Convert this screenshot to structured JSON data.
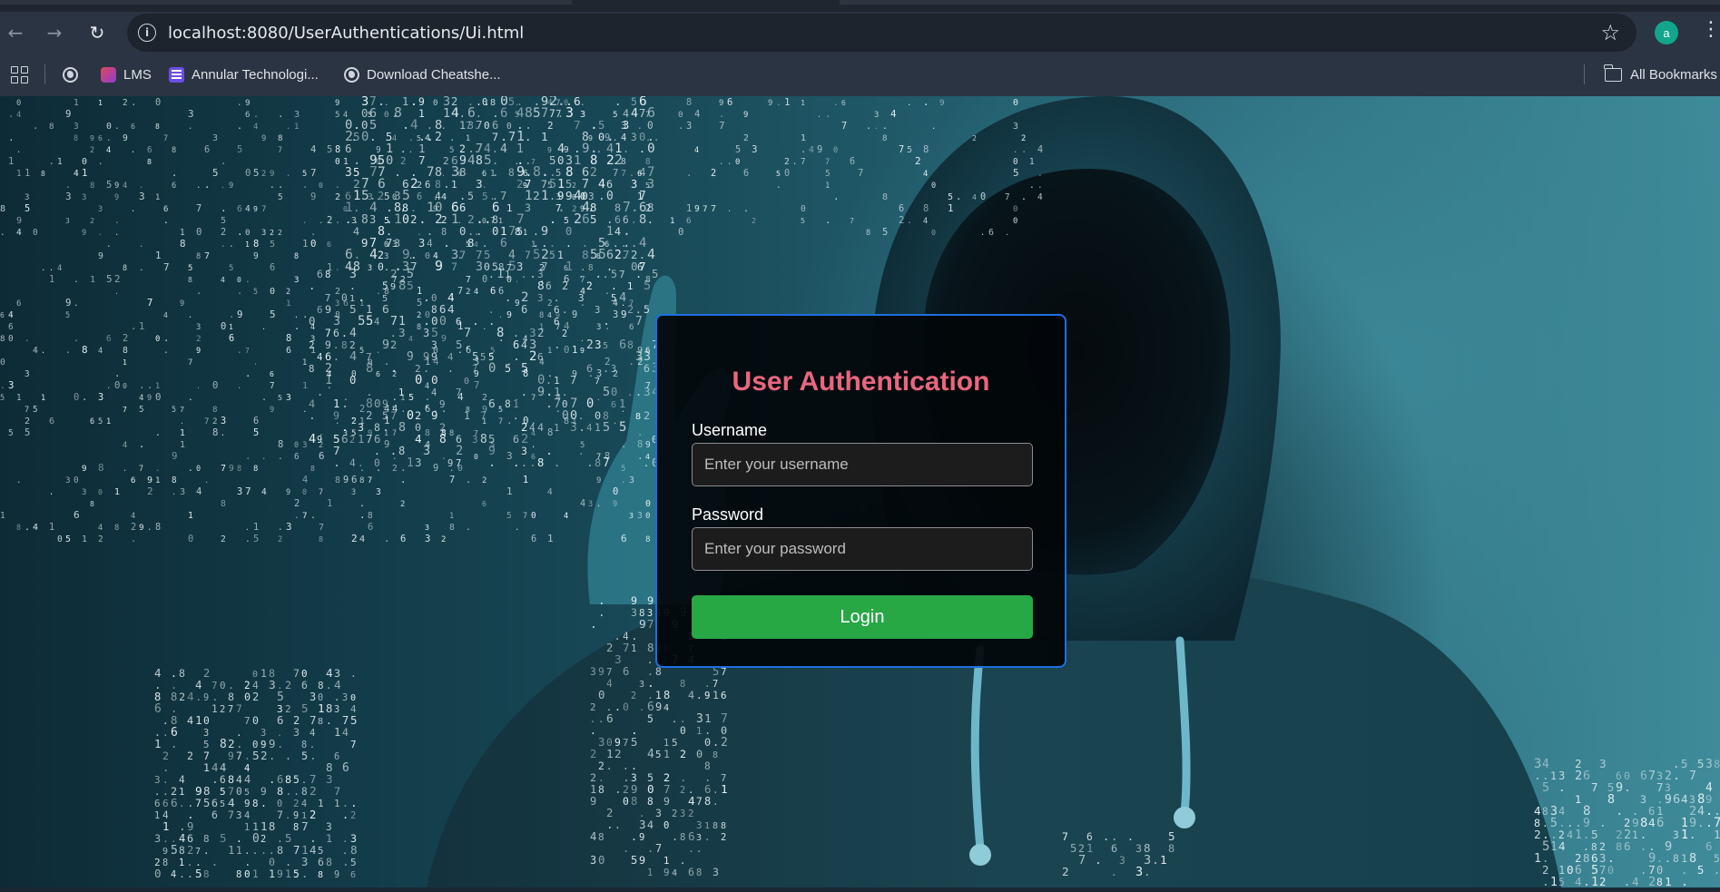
{
  "browser": {
    "url": "localhost:8080/UserAuthentications/Ui.html",
    "profile_initial": "a",
    "bookmarks": [
      {
        "label": "LMS",
        "icon": "lms-icon"
      },
      {
        "label": "Annular Technologi...",
        "icon": "list-icon"
      },
      {
        "label": "Download Cheatshe...",
        "icon": "globe-icon"
      }
    ],
    "all_bookmarks_label": "All Bookmarks"
  },
  "form": {
    "title": "User Authentication",
    "username_label": "Username",
    "username_placeholder": "Enter your username",
    "password_label": "Password",
    "password_placeholder": "Enter your password",
    "login_label": "Login"
  },
  "background": {
    "description_image": "hooded-figure-binary-digits",
    "accent_colors": {
      "card_border": "#1d6fe0",
      "title": "#e9667f",
      "button": "#28a745"
    }
  }
}
